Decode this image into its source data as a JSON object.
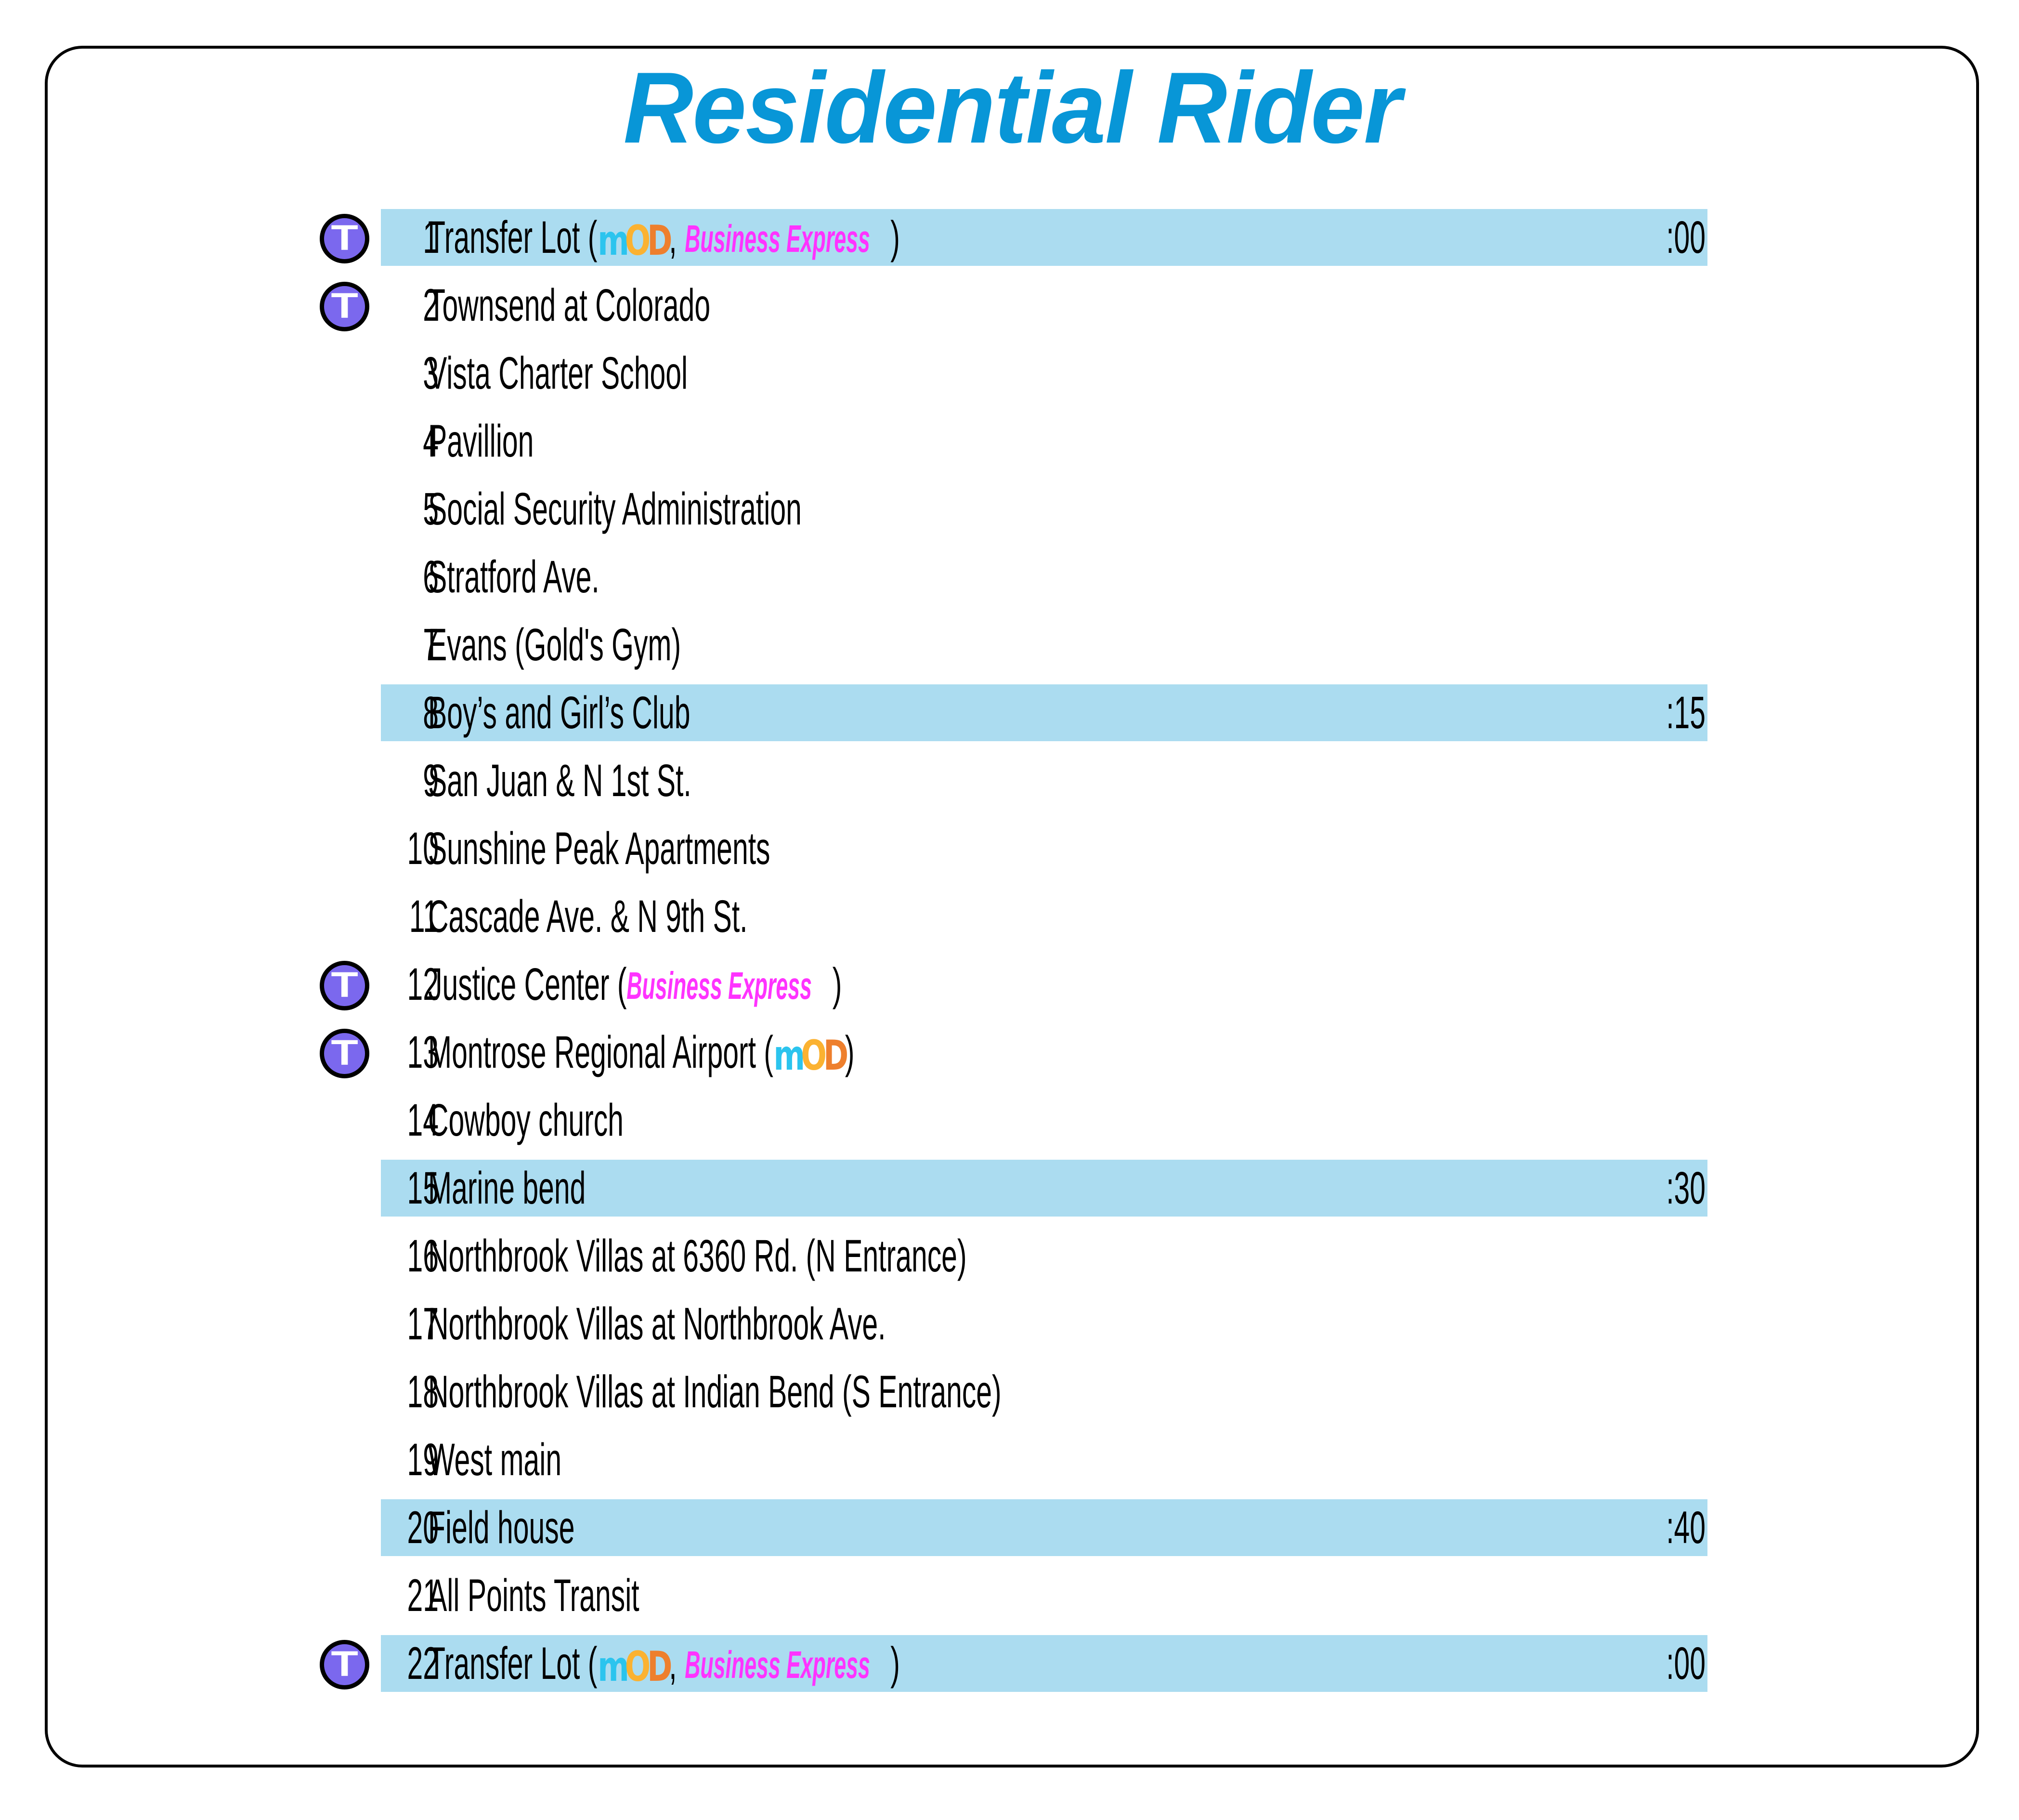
{
  "title": "Residential Rider",
  "colors": {
    "title_blue": "#0896D7",
    "highlight_blue": "#ABDCF0",
    "badge_purple": "#7B68EE",
    "mod_m": "#2BC4EE",
    "mod_o": "#FBB231",
    "mod_d": "#EE7F2D",
    "business_express_magenta": "#FF33FF",
    "text_black": "#000000",
    "border_black": "#000000",
    "page_background": "#FFFFFF"
  },
  "legend": {
    "transfer_badge_letter": "T",
    "mod_logo_text": "MOD",
    "business_express_text": "Business Express"
  },
  "stops": [
    {
      "num": "1",
      "pre": "Transfer Lot (",
      "mod": true,
      "sep": ", ",
      "bx": true,
      "post": ")",
      "time": ":00",
      "highlight": true,
      "transfer": true
    },
    {
      "num": "2",
      "pre": "Townsend at Colorado",
      "mod": false,
      "sep": "",
      "bx": false,
      "post": "",
      "time": "",
      "highlight": false,
      "transfer": true
    },
    {
      "num": "3",
      "pre": "Vista Charter School",
      "mod": false,
      "sep": "",
      "bx": false,
      "post": "",
      "time": "",
      "highlight": false,
      "transfer": false
    },
    {
      "num": "4",
      "pre": "Pavillion",
      "mod": false,
      "sep": "",
      "bx": false,
      "post": "",
      "time": "",
      "highlight": false,
      "transfer": false
    },
    {
      "num": "5",
      "pre": "Social Security Administration",
      "mod": false,
      "sep": "",
      "bx": false,
      "post": "",
      "time": "",
      "highlight": false,
      "transfer": false
    },
    {
      "num": "6",
      "pre": "Stratford Ave.",
      "mod": false,
      "sep": "",
      "bx": false,
      "post": "",
      "time": "",
      "highlight": false,
      "transfer": false
    },
    {
      "num": "7",
      "pre": "Evans (Gold's Gym)",
      "mod": false,
      "sep": "",
      "bx": false,
      "post": "",
      "time": "",
      "highlight": false,
      "transfer": false
    },
    {
      "num": "8",
      "pre": "Boy’s and Girl’s Club",
      "mod": false,
      "sep": "",
      "bx": false,
      "post": "",
      "time": ":15",
      "highlight": true,
      "transfer": false
    },
    {
      "num": "9",
      "pre": "San Juan & N 1st St.",
      "mod": false,
      "sep": "",
      "bx": false,
      "post": "",
      "time": "",
      "highlight": false,
      "transfer": false
    },
    {
      "num": "10",
      "pre": "Sunshine Peak Apartments",
      "mod": false,
      "sep": "",
      "bx": false,
      "post": "",
      "time": "",
      "highlight": false,
      "transfer": false
    },
    {
      "num": "11",
      "pre": "Cascade Ave. & N 9th St.",
      "mod": false,
      "sep": "",
      "bx": false,
      "post": "",
      "time": "",
      "highlight": false,
      "transfer": false
    },
    {
      "num": "12",
      "pre": "Justice Center (",
      "mod": false,
      "sep": "",
      "bx": true,
      "post": ")",
      "time": "",
      "highlight": false,
      "transfer": true
    },
    {
      "num": "13",
      "pre": "Montrose Regional Airport (",
      "mod": true,
      "sep": "",
      "bx": false,
      "post": ")",
      "time": "",
      "highlight": false,
      "transfer": true
    },
    {
      "num": "14",
      "pre": "Cowboy church",
      "mod": false,
      "sep": "",
      "bx": false,
      "post": "",
      "time": "",
      "highlight": false,
      "transfer": false
    },
    {
      "num": "15",
      "pre": "Marine bend",
      "mod": false,
      "sep": "",
      "bx": false,
      "post": "",
      "time": ":30",
      "highlight": true,
      "transfer": false
    },
    {
      "num": "16",
      "pre": "Northbrook Villas at 6360 Rd. (N Entrance)",
      "mod": false,
      "sep": "",
      "bx": false,
      "post": "",
      "time": "",
      "highlight": false,
      "transfer": false
    },
    {
      "num": "17",
      "pre": "Northbrook Villas at Northbrook Ave.",
      "mod": false,
      "sep": "",
      "bx": false,
      "post": "",
      "time": "",
      "highlight": false,
      "transfer": false
    },
    {
      "num": "18",
      "pre": "Northbrook Villas at Indian Bend (S Entrance)",
      "mod": false,
      "sep": "",
      "bx": false,
      "post": "",
      "time": "",
      "highlight": false,
      "transfer": false
    },
    {
      "num": "19",
      "pre": "West main",
      "mod": false,
      "sep": "",
      "bx": false,
      "post": "",
      "time": "",
      "highlight": false,
      "transfer": false
    },
    {
      "num": "20",
      "pre": "Field house",
      "mod": false,
      "sep": "",
      "bx": false,
      "post": "",
      "time": ":40",
      "highlight": true,
      "transfer": false
    },
    {
      "num": "21",
      "pre": "All Points Transit",
      "mod": false,
      "sep": "",
      "bx": false,
      "post": "",
      "time": "",
      "highlight": false,
      "transfer": false
    },
    {
      "num": "22",
      "pre": "Transfer Lot (",
      "mod": true,
      "sep": ", ",
      "bx": true,
      "post": ")",
      "time": ":00",
      "highlight": true,
      "transfer": true
    }
  ]
}
